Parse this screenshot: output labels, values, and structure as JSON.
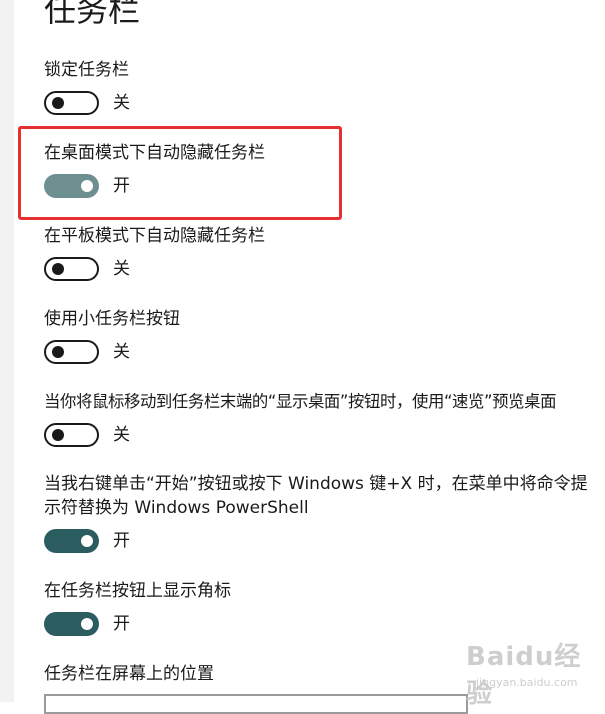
{
  "page": {
    "title": "任务栏"
  },
  "settings": [
    {
      "label": "锁定任务栏",
      "state": "off",
      "state_label": "关"
    },
    {
      "label": "在桌面模式下自动隐藏任务栏",
      "state": "on",
      "state_label": "开"
    },
    {
      "label": "在平板模式下自动隐藏任务栏",
      "state": "off",
      "state_label": "关"
    },
    {
      "label": "使用小任务栏按钮",
      "state": "off",
      "state_label": "关"
    },
    {
      "label": "当你将鼠标移动到任务栏末端的“显示桌面”按钮时，使用“速览”预览桌面",
      "state": "off",
      "state_label": "关"
    },
    {
      "label": "当我右键单击“开始”按钮或按下 Windows 键+X 时，在菜单中将命令提示符替换为 Windows PowerShell",
      "state": "on",
      "state_label": "开"
    },
    {
      "label": "在任务栏按钮上显示角标",
      "state": "on",
      "state_label": "开"
    }
  ],
  "position_section": {
    "label": "任务栏在屏幕上的位置"
  },
  "watermark": {
    "main": "Baidu经验",
    "sub": "jingyan.baidu.com"
  },
  "colors": {
    "toggle_on": "#2b5c60",
    "toggle_on_highlighted": "#6e8f90",
    "highlight_border": "#e63030"
  }
}
